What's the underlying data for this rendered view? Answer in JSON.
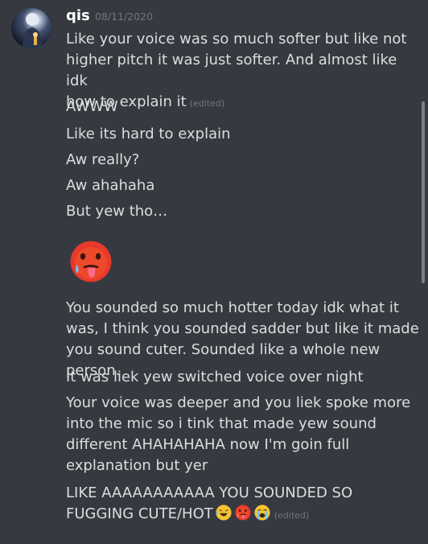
{
  "message_group": {
    "author": "qis",
    "timestamp": "08/11/2020",
    "edited_label": "(edited)",
    "messages": [
      "Like your voice was so much softer but like not\nhigher pitch it was just softer. And almost like idk\nhow to explain it",
      "AWWW",
      "Like its hard to explain",
      "Aw really?",
      "Aw ahahaha",
      "But yew tho…",
      "You sounded so much hotter today idk what it\nwas, I think you sounded sadder but like it made\nyou sound cuter. Sounded like a whole new person.",
      "It was liek yew switched voice over night",
      "Your voice was deeper and you liek spoke more\ninto the mic  so i tink that made yew sound\ndifferent AHAHAHAHA now I'm goin full\nexplanation but yer",
      "LIKE AAAAAAAAAAA YOU SOUNDED SO\nFUGGING CUTE/HOT"
    ],
    "emoji": {
      "big": "hot-face-emoji",
      "reactions": [
        "rolling-on-floor-laughing-emoji",
        "hot-face-emoji",
        "loudly-crying-emoji"
      ]
    }
  },
  "colors": {
    "background": "#36393f",
    "text": "#dcddde",
    "username": "#ffffff",
    "muted": "#72767d"
  }
}
